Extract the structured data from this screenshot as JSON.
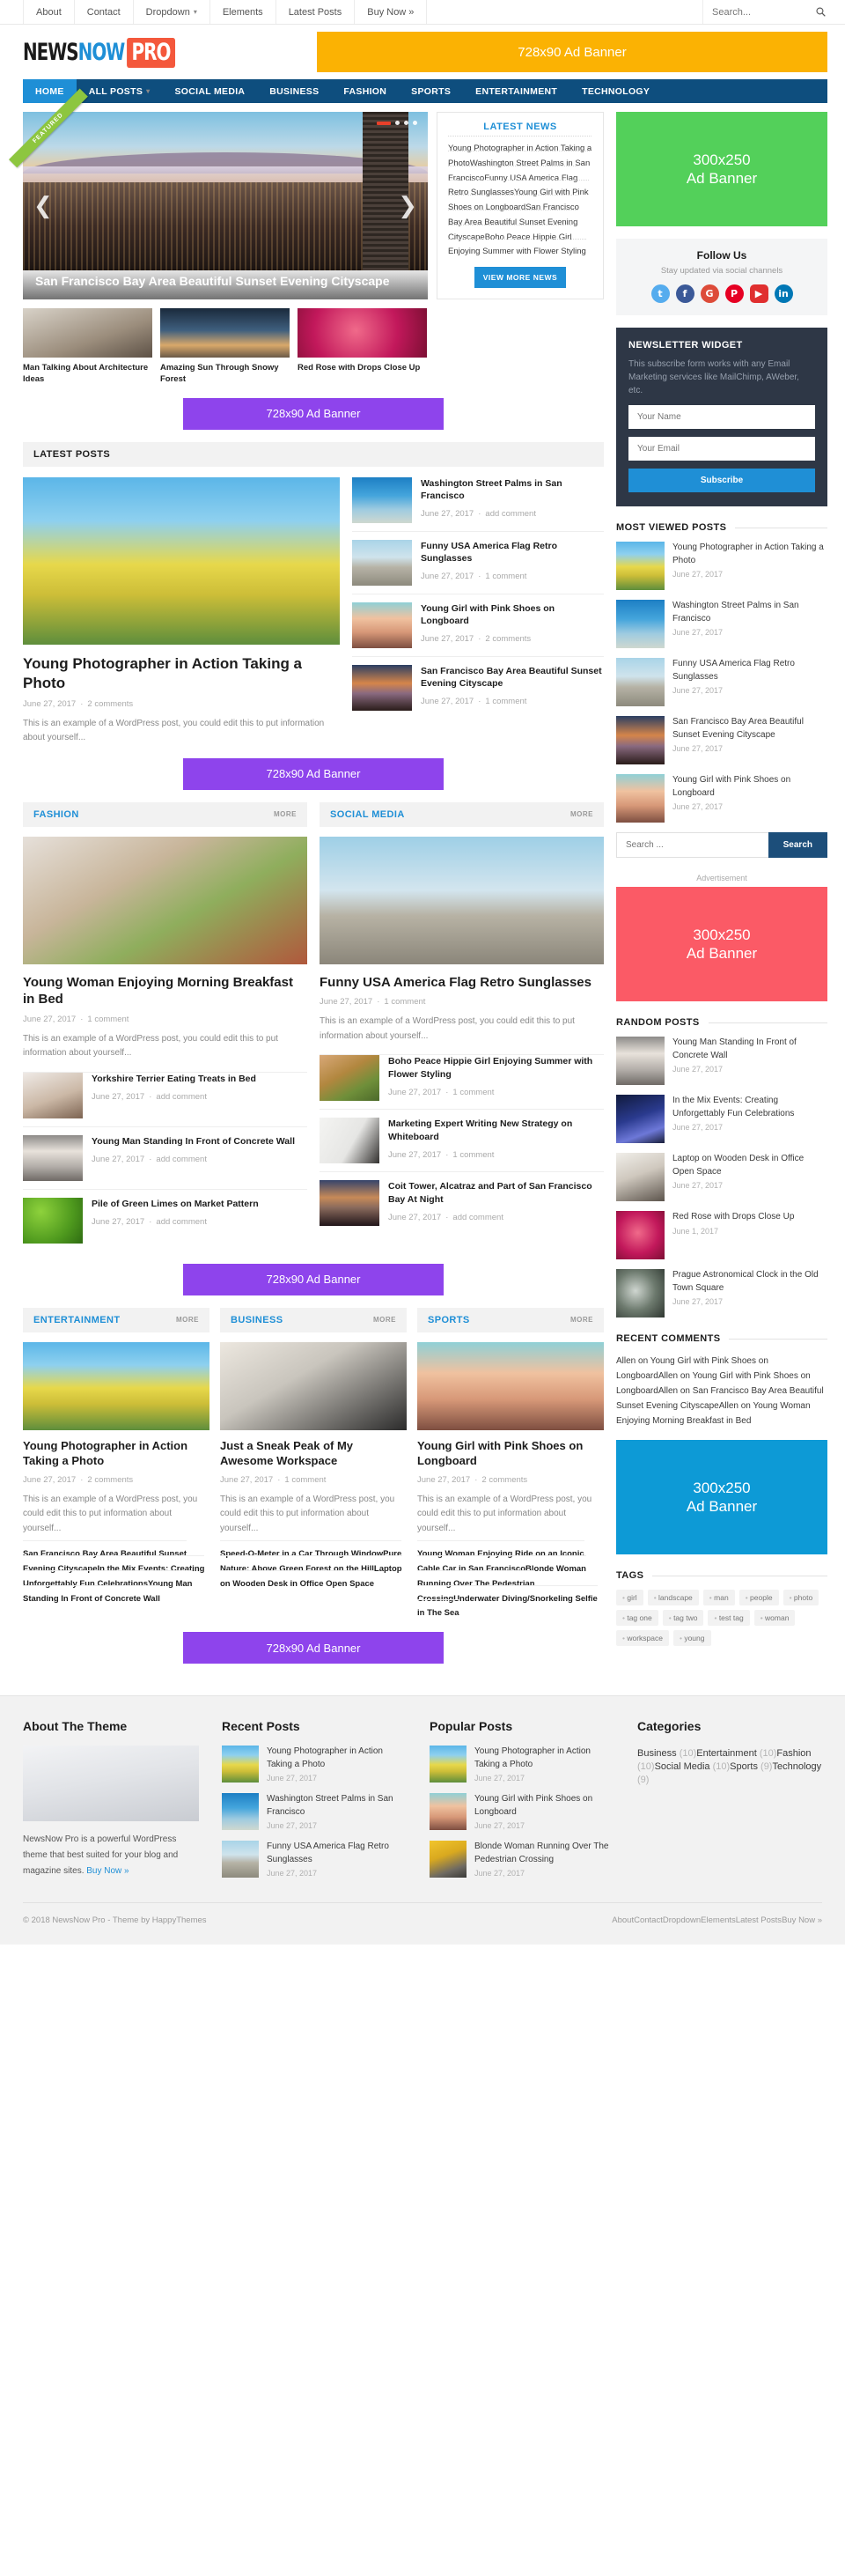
{
  "topbar": {
    "items": [
      {
        "label": "About",
        "has_caret": false
      },
      {
        "label": "Contact",
        "has_caret": false
      },
      {
        "label": "Dropdown",
        "has_caret": true
      },
      {
        "label": "Elements",
        "has_caret": false
      },
      {
        "label": "Latest Posts",
        "has_caret": false
      },
      {
        "label": "Buy Now »",
        "has_caret": false
      }
    ],
    "search_placeholder": "Search...",
    "search_value": ""
  },
  "logo": {
    "news": "NEWS",
    "now": "NOW",
    "pro": "PRO"
  },
  "header_ad": {
    "label": "728x90 Ad Banner",
    "color": "#fbb203"
  },
  "mainnav": {
    "items": [
      {
        "label": "HOME",
        "active": true,
        "caret": false
      },
      {
        "label": "ALL POSTS",
        "active": false,
        "caret": true
      },
      {
        "label": "SOCIAL MEDIA",
        "active": false,
        "caret": false
      },
      {
        "label": "BUSINESS",
        "active": false,
        "caret": false
      },
      {
        "label": "FASHION",
        "active": false,
        "caret": false
      },
      {
        "label": "SPORTS",
        "active": false,
        "caret": false
      },
      {
        "label": "ENTERTAINMENT",
        "active": false,
        "caret": false
      },
      {
        "label": "TECHNOLOGY",
        "active": false,
        "caret": false
      }
    ]
  },
  "slider": {
    "ribbon": "FEATURED",
    "caption": "San Francisco Bay Area Beautiful Sunset Evening Cityscape",
    "prev_icon": "chevron-left",
    "next_icon": "chevron-right",
    "dots": 4
  },
  "thumbs": [
    {
      "title": "Man Talking About Architecture Ideas",
      "img": "t1"
    },
    {
      "title": "Amazing Sun Through Snowy Forest",
      "img": "t2"
    },
    {
      "title": "Red Rose with Drops Close Up",
      "img": "t3"
    }
  ],
  "latest_news": {
    "title": "LATEST NEWS",
    "items": [
      "Young Photographer in Action Taking a Photo",
      "Washington Street Palms in San Francisco",
      "Funny USA America Flag Retro Sunglasses",
      "Young Girl with Pink Shoes on Longboard",
      "San Francisco Bay Area Beautiful Sunset Evening Cityscape",
      "Boho Peace Hippie Girl Enjoying Summer with Flower Styling"
    ],
    "button": "VIEW MORE NEWS"
  },
  "ads": {
    "banner728": "728x90 Ad Banner",
    "green": {
      "size": "300x250",
      "label": "Ad Banner",
      "color": "#53d05a"
    },
    "red": {
      "size": "300x250",
      "label": "Ad Banner",
      "color": "#fb5a66"
    },
    "blue": {
      "size": "300x250",
      "label": "Ad Banner",
      "color": "#0d9ad6"
    },
    "advertisement_label": "Advertisement"
  },
  "follow": {
    "title": "Follow Us",
    "subtitle": "Stay updated via social channels",
    "networks": [
      "twitter",
      "facebook",
      "google-plus",
      "pinterest",
      "youtube",
      "linkedin"
    ]
  },
  "newsletter": {
    "title": "NEWSLETTER WIDGET",
    "desc": "This subscribe form works with any Email Marketing services like MailChimp, AWeber, etc.",
    "name_placeholder": "Your Name",
    "email_placeholder": "Your Email",
    "name_value": "",
    "email_value": "",
    "button": "Subscribe"
  },
  "most_viewed": {
    "title": "MOST VIEWED POSTS",
    "items": [
      {
        "title": "Young Photographer in Action Taking a Photo",
        "date": "June 27, 2017",
        "img": "img-photographer"
      },
      {
        "title": "Washington Street Palms in San Francisco",
        "date": "June 27, 2017",
        "img": "img-palms"
      },
      {
        "title": "Funny USA America Flag Retro Sunglasses",
        "date": "June 27, 2017",
        "img": "img-sunglasses"
      },
      {
        "title": "San Francisco Bay Area Beautiful Sunset Evening Cityscape",
        "date": "June 27, 2017",
        "img": "img-sfbay"
      },
      {
        "title": "Young Girl with Pink Shoes on Longboard",
        "date": "June 27, 2017",
        "img": "img-longboard"
      }
    ]
  },
  "sidebar_search": {
    "placeholder": "Search ...",
    "value": "",
    "button": "Search"
  },
  "random_posts": {
    "title": "RANDOM POSTS",
    "items": [
      {
        "title": "Young Man Standing In Front of Concrete Wall",
        "date": "June 27, 2017",
        "img": "img-concrete"
      },
      {
        "title": "In the Mix Events: Creating Unforgettably Fun Celebrations",
        "date": "June 27, 2017",
        "img": "img-mixevents"
      },
      {
        "title": "Laptop on Wooden Desk in Office Open Space",
        "date": "June 27, 2017",
        "img": "img-laptopdesk"
      },
      {
        "title": "Red Rose with Drops Close Up",
        "date": "June 1, 2017",
        "img": "img-rose"
      },
      {
        "title": "Prague Astronomical Clock in the Old Town Square",
        "date": "June 27, 2017",
        "img": "img-clock"
      }
    ]
  },
  "recent_comments": {
    "title": "RECENT COMMENTS",
    "items": [
      "Allen on Young Girl with Pink Shoes on Longboard",
      "Allen on Young Girl with Pink Shoes on Longboard",
      "Allen on San Francisco Bay Area Beautiful Sunset Evening Cityscape",
      "Allen on Young Woman Enjoying Morning Breakfast in Bed"
    ]
  },
  "tags": {
    "title": "TAGS",
    "items": [
      "girl",
      "landscape",
      "man",
      "people",
      "photo",
      "tag one",
      "tag two",
      "test tag",
      "woman",
      "workspace",
      "young"
    ]
  },
  "latest_posts": {
    "heading": "LATEST POSTS",
    "feature": {
      "title": "Young Photographer in Action Taking a Photo",
      "date": "June 27, 2017",
      "comments": "2 comments",
      "excerpt": "This is an example of a WordPress post, you could edit this to put information about yourself...",
      "img": "img-photographer"
    },
    "list": [
      {
        "title": "Washington Street Palms in San Francisco",
        "date": "June 27, 2017",
        "comments": "add comment",
        "img": "img-palms"
      },
      {
        "title": "Funny USA America Flag Retro Sunglasses",
        "date": "June 27, 2017",
        "comments": "1 comment",
        "img": "img-sunglasses"
      },
      {
        "title": "Young Girl with Pink Shoes on Longboard",
        "date": "June 27, 2017",
        "comments": "2 comments",
        "img": "img-longboard"
      },
      {
        "title": "San Francisco Bay Area Beautiful Sunset Evening Cityscape",
        "date": "June 27, 2017",
        "comments": "1 comment",
        "img": "img-sfbay"
      }
    ]
  },
  "two_columns": [
    {
      "name": "FASHION",
      "more": "MORE",
      "feature": {
        "title": "Young Woman Enjoying Morning Breakfast in Bed",
        "date": "June 27, 2017",
        "comments": "1 comment",
        "excerpt": "This is an example of a WordPress post, you could edit this to put information about yourself...",
        "img": "img-breakfast"
      },
      "list": [
        {
          "title": "Yorkshire Terrier Eating Treats in Bed",
          "date": "June 27, 2017",
          "comments": "add comment",
          "img": "img-terrier"
        },
        {
          "title": "Young Man Standing In Front of Concrete Wall",
          "date": "June 27, 2017",
          "comments": "add comment",
          "img": "img-concrete"
        },
        {
          "title": "Pile of Green Limes on Market Pattern",
          "date": "June 27, 2017",
          "comments": "add comment",
          "img": "img-limes"
        }
      ]
    },
    {
      "name": "SOCIAL MEDIA",
      "more": "MORE",
      "feature": {
        "title": "Funny USA America Flag Retro Sunglasses",
        "date": "June 27, 2017",
        "comments": "1 comment",
        "excerpt": "This is an example of a WordPress post, you could edit this to put information about yourself...",
        "img": "img-usaflag"
      },
      "list": [
        {
          "title": "Boho Peace Hippie Girl Enjoying Summer with Flower Styling",
          "date": "June 27, 2017",
          "comments": "1 comment",
          "img": "img-boho"
        },
        {
          "title": "Marketing Expert Writing New Strategy on Whiteboard",
          "date": "June 27, 2017",
          "comments": "1 comment",
          "img": "img-whiteboard"
        },
        {
          "title": "Coit Tower, Alcatraz and Part of San Francisco Bay At Night",
          "date": "June 27, 2017",
          "comments": "add comment",
          "img": "img-coit"
        }
      ]
    }
  ],
  "three_columns": [
    {
      "name": "ENTERTAINMENT",
      "more": "MORE",
      "feature": {
        "title": "Young Photographer in Action Taking a Photo",
        "date": "June 27, 2017",
        "comments": "2 comments",
        "excerpt": "This is an example of a WordPress post, you could edit this to put information about yourself...",
        "img": "img-photographer"
      },
      "list": [
        "San Francisco Bay Area Beautiful Sunset Evening Cityscape",
        "In the Mix Events: Creating Unforgettably Fun Celebrations",
        "Young Man Standing In Front of Concrete Wall"
      ]
    },
    {
      "name": "BUSINESS",
      "more": "MORE",
      "feature": {
        "title": "Just a Sneak Peak of My Awesome Workspace",
        "date": "June 27, 2017",
        "comments": "1 comment",
        "excerpt": "This is an example of a WordPress post, you could edit this to put information about yourself...",
        "img": "img-workspace"
      },
      "list": [
        "Speed-O-Meter in a Car Through Window",
        "Pure Nature: Above Green Forest on the Hill",
        "Laptop on Wooden Desk in Office Open Space"
      ]
    },
    {
      "name": "SPORTS",
      "more": "MORE",
      "feature": {
        "title": "Young Girl with Pink Shoes on Longboard",
        "date": "June 27, 2017",
        "comments": "2 comments",
        "excerpt": "This is an example of a WordPress post, you could edit this to put information about yourself...",
        "img": "img-longboard"
      },
      "list": [
        "Young Woman Enjoying Ride on an Iconic Cable Car in San Francisco",
        "Blonde Woman Running Over The Pedestrian Crossing",
        "Underwater Diving/Snorkeling Selfie in The Sea"
      ]
    }
  ],
  "footer": {
    "about": {
      "title": "About The Theme",
      "text_before": "NewsNow Pro is a powerful WordPress theme that best suited for your blog and magazine sites. ",
      "link": "Buy Now »"
    },
    "recent_posts": {
      "title": "Recent Posts",
      "items": [
        {
          "title": "Young Photographer in Action Taking a Photo",
          "date": "June 27, 2017",
          "img": "img-photographer"
        },
        {
          "title": "Washington Street Palms in San Francisco",
          "date": "June 27, 2017",
          "img": "img-palms"
        },
        {
          "title": "Funny USA America Flag Retro Sunglasses",
          "date": "June 27, 2017",
          "img": "img-sunglasses"
        }
      ]
    },
    "popular_posts": {
      "title": "Popular Posts",
      "items": [
        {
          "title": "Young Photographer in Action Taking a Photo",
          "date": "June 27, 2017",
          "img": "img-photographer"
        },
        {
          "title": "Young Girl with Pink Shoes on Longboard",
          "date": "June 27, 2017",
          "img": "img-longboard"
        },
        {
          "title": "Blonde Woman Running Over The Pedestrian Crossing",
          "date": "June 27, 2017",
          "img": "img-crossing"
        }
      ]
    },
    "categories": {
      "title": "Categories",
      "items": [
        {
          "name": "Business",
          "count": "(10)"
        },
        {
          "name": "Entertainment",
          "count": "(10)"
        },
        {
          "name": "Fashion",
          "count": "(10)"
        },
        {
          "name": "Social Media",
          "count": "(10)"
        },
        {
          "name": "Sports",
          "count": "(9)"
        },
        {
          "name": "Technology",
          "count": "(9)"
        }
      ]
    },
    "copyright": "© 2018 NewsNow Pro - Theme by HappyThemes",
    "nav": [
      "About",
      "Contact",
      "Dropdown",
      "Elements",
      "Latest Posts",
      "Buy Now »"
    ]
  }
}
